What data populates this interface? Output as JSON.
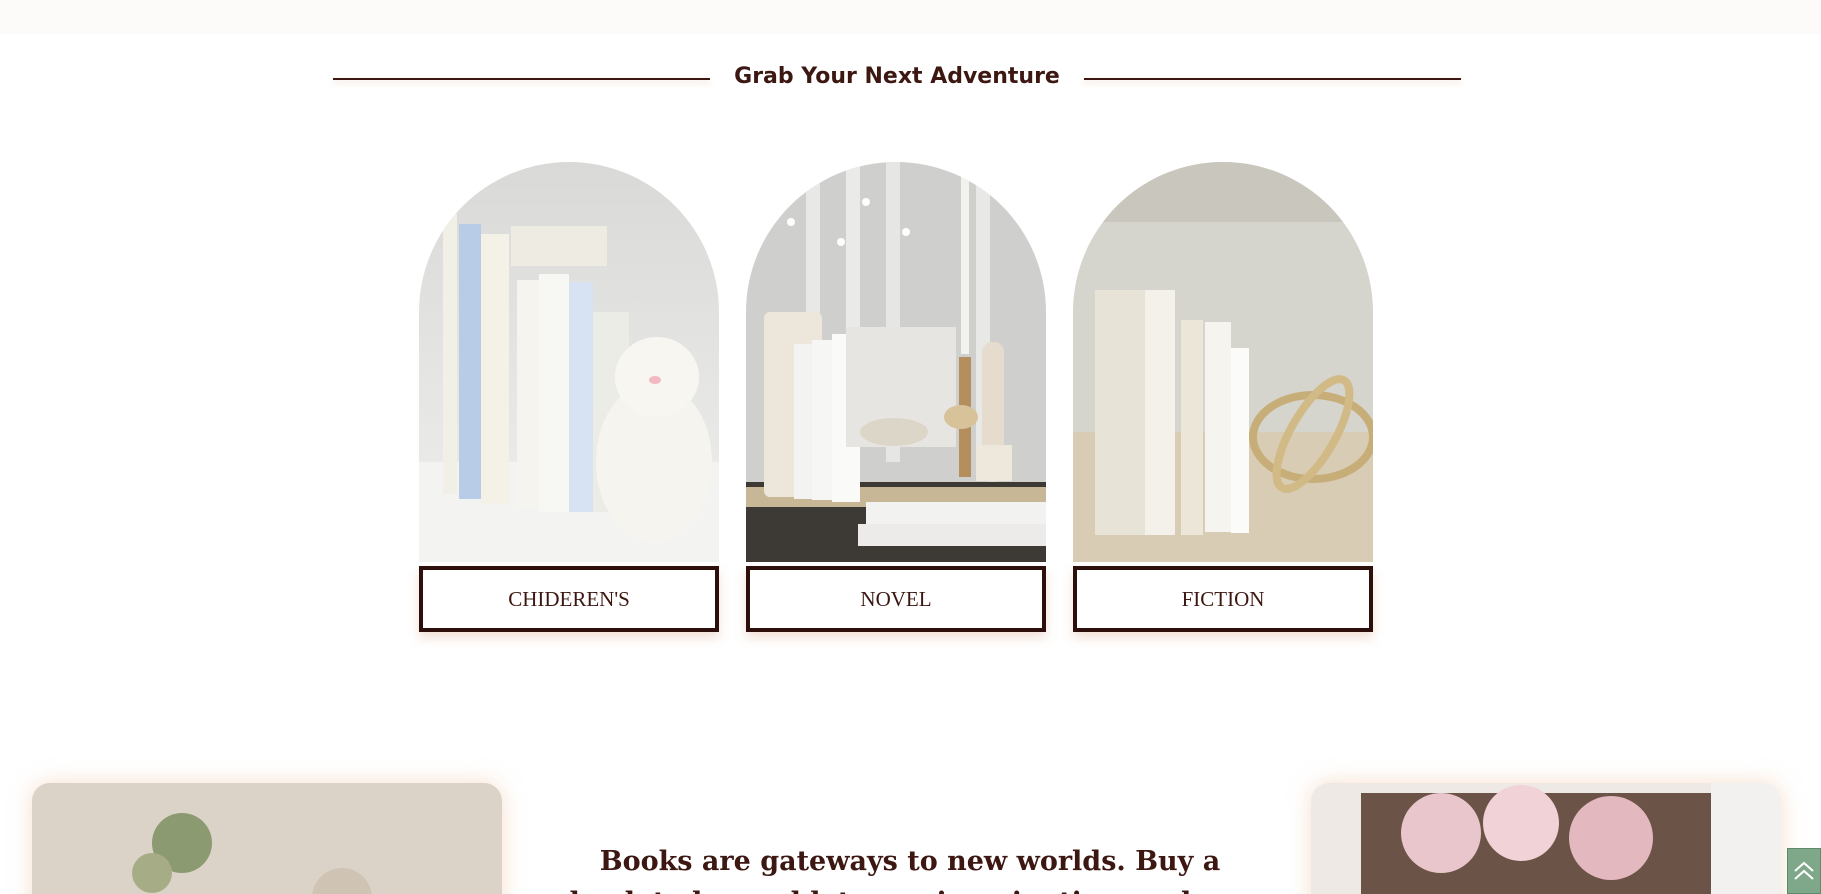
{
  "section": {
    "title": "Grab Your Next Adventure"
  },
  "categories": [
    {
      "label": "CHIDEREN'S",
      "image": "children-books-bunny-image"
    },
    {
      "label": "NOVEL",
      "image": "novel-books-candles-image"
    },
    {
      "label": "FICTION",
      "image": "fiction-books-sculpture-image"
    }
  ],
  "feature": {
    "quote": "Books are gateways to new worlds. Buy a book today and let your imagination explore."
  },
  "icons": {
    "scroll_top": "double-chevron-up-icon"
  },
  "colors": {
    "brand_brown": "#3d1812",
    "button_border": "#2d0f0b",
    "scroll_button": "#7fa78a"
  }
}
